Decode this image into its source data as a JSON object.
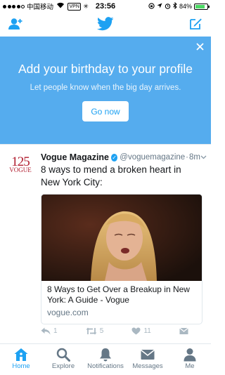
{
  "status_bar": {
    "carrier": "中国移动",
    "vpn": "VPN",
    "time": "23:56",
    "battery_text": "84%",
    "battery_level": 0.84,
    "signal_filled": 4,
    "signal_total": 5
  },
  "colors": {
    "twitter_blue": "#1da1f2",
    "banner_blue": "#55acee",
    "muted": "#657786"
  },
  "banner": {
    "title": "Add your birthday to your profile",
    "subtitle": "Let people know when the big day arrives.",
    "button": "Go now"
  },
  "tweet": {
    "avatar_number": "125",
    "avatar_word": "VOGUE",
    "name": "Vogue Magazine",
    "handle": "@voguemagazine",
    "separator": "·",
    "time": "8m",
    "text": "8 ways to mend a broken heart in New York City:",
    "card": {
      "title": "8 Ways to Get Over a Breakup in New York: A Guide - Vogue",
      "domain": "vogue.com"
    },
    "actions": {
      "replies": "1",
      "retweets": "5",
      "likes": "11"
    }
  },
  "tabs": [
    {
      "label": "Home",
      "icon": "home-icon",
      "active": true
    },
    {
      "label": "Explore",
      "icon": "search-icon",
      "active": false
    },
    {
      "label": "Notifications",
      "icon": "bell-icon",
      "active": false
    },
    {
      "label": "Messages",
      "icon": "envelope-icon",
      "active": false
    },
    {
      "label": "Me",
      "icon": "person-icon",
      "active": false
    }
  ]
}
